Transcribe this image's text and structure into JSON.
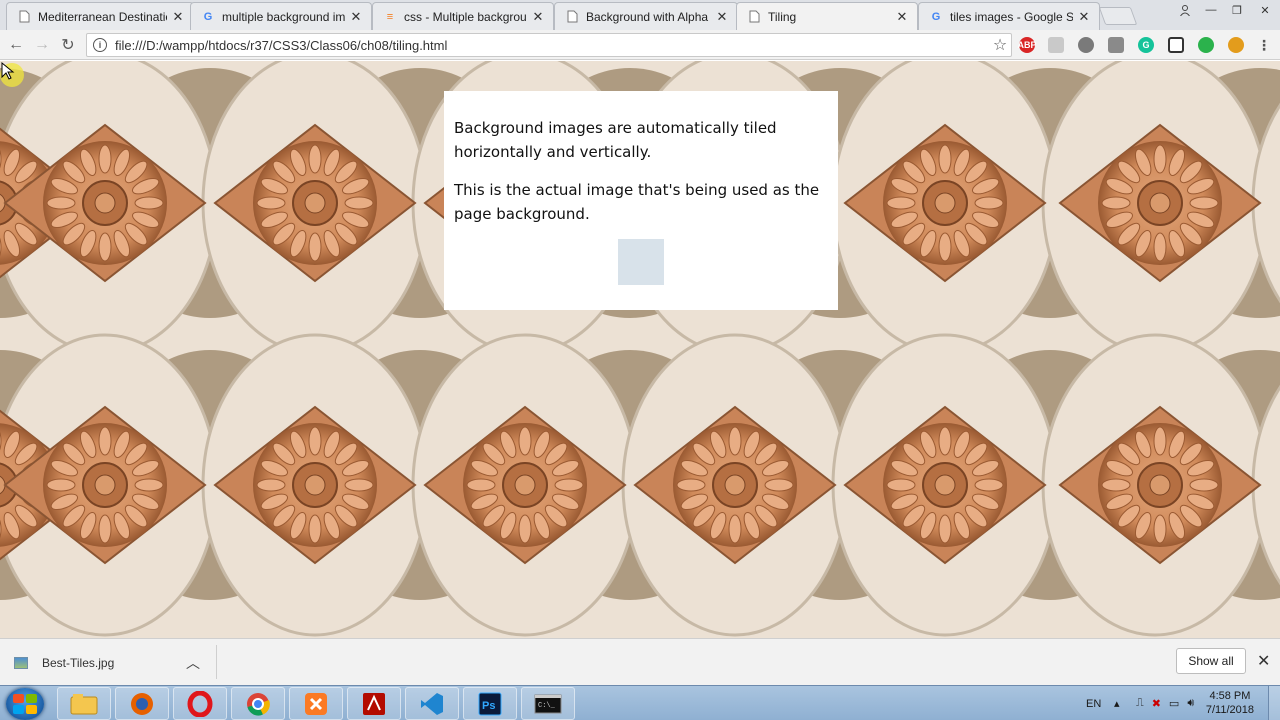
{
  "browser": {
    "tabs": [
      {
        "title": "Mediterranean Destinatic",
        "favicon": "page-icon",
        "active": false
      },
      {
        "title": "multiple background ima",
        "favicon": "google-icon",
        "active": false
      },
      {
        "title": "css - Multiple backgrounc",
        "favicon": "stackoverflow-icon",
        "active": false
      },
      {
        "title": "Background with Alpha T",
        "favicon": "page-icon",
        "active": false
      },
      {
        "title": "Tiling",
        "favicon": "page-icon",
        "active": true
      },
      {
        "title": "tiles images - Google Sea",
        "favicon": "google-icon",
        "active": false
      }
    ],
    "address": "file:///D:/wampp/htdocs/r37/CSS3/Class06/ch08/tiling.html",
    "extensions": [
      "abp-icon",
      "acrobat-icon",
      "extension-icon",
      "camera-icon",
      "grammarly-icon",
      "screenshot-icon",
      "feedly-icon",
      "settings-gear-icon"
    ]
  },
  "page": {
    "paragraph1": "Background images are automatically tiled horizontally and vertically.",
    "paragraph2": "This is the actual image that's being used as the page background.",
    "colors": {
      "background": "#ece1d4",
      "arch_dark": "#a38e72",
      "flower": "#d08a5a",
      "thumb": "#d8e2ea"
    }
  },
  "downloads": {
    "file_name": "Best-Tiles.jpg",
    "show_all": "Show all"
  },
  "taskbar": {
    "apps": [
      "explorer-icon",
      "firefox-icon",
      "opera-icon",
      "chrome-icon",
      "xampp-icon",
      "acrobat-icon",
      "vscode-icon",
      "photoshop-icon",
      "cmd-icon"
    ],
    "language": "EN",
    "time": "4:58 PM",
    "date": "7/11/2018"
  }
}
